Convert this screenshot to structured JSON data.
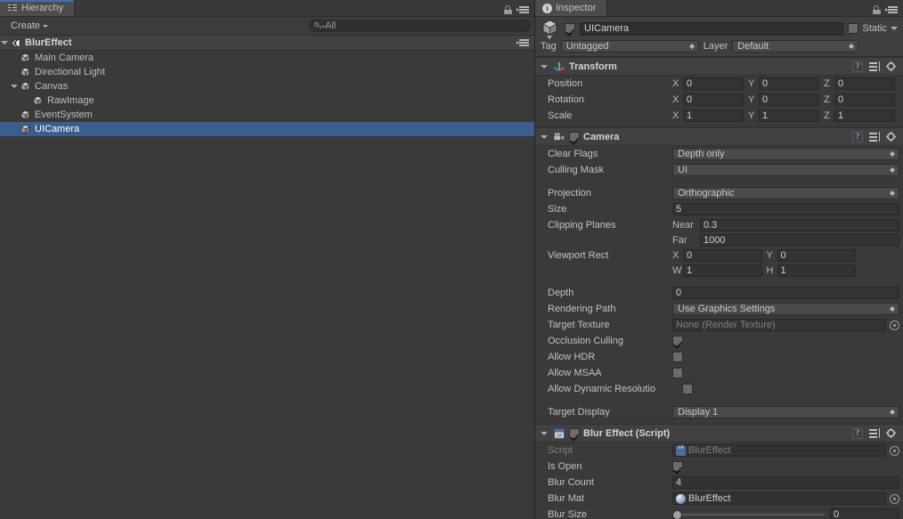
{
  "hierarchy": {
    "tab_label": "Hierarchy",
    "tab_icon": "hierarchy-icon",
    "lock_icon": "lock-icon",
    "menu_icon": "hamburger-menu-icon",
    "toolbar": {
      "create_label": "Create",
      "search_value": "All",
      "search_icon": "search-icon"
    },
    "scene": {
      "name": "BlurEffect",
      "icon": "unity-scene-icon",
      "expanded": true
    },
    "items": [
      {
        "label": "Main Camera",
        "icon": "gameobject-cube-icon",
        "depth": 1,
        "expandable": false,
        "selected": false
      },
      {
        "label": "Directional Light",
        "icon": "gameobject-cube-icon",
        "depth": 1,
        "expandable": false,
        "selected": false
      },
      {
        "label": "Canvas",
        "icon": "gameobject-cube-icon",
        "depth": 1,
        "expandable": true,
        "selected": false
      },
      {
        "label": "RawImage",
        "icon": "gameobject-cube-icon",
        "depth": 2,
        "expandable": false,
        "selected": false
      },
      {
        "label": "EventSystem",
        "icon": "gameobject-cube-icon",
        "depth": 1,
        "expandable": false,
        "selected": false
      },
      {
        "label": "UICamera",
        "icon": "gameobject-cube-icon",
        "depth": 1,
        "expandable": false,
        "selected": true
      }
    ]
  },
  "inspector": {
    "tab_label": "Inspector",
    "tab_icon": "info-icon",
    "lock_icon": "lock-icon",
    "menu_icon": "hamburger-menu-icon",
    "object": {
      "icon": "gameobject-cube-icon",
      "enabled": true,
      "name": "UICamera",
      "static_label": "Static",
      "static_checked": false,
      "tag_label": "Tag",
      "tag_value": "Untagged",
      "layer_label": "Layer",
      "layer_value": "Default"
    },
    "components": [
      {
        "title": "Transform",
        "icon": "transform-gizmo-icon",
        "has_enable_checkbox": false,
        "expanded": true,
        "tools": [
          "help-icon",
          "preset-icon",
          "gear-icon"
        ],
        "vectors": [
          {
            "label": "Position",
            "x": "0",
            "y": "0",
            "z": "0"
          },
          {
            "label": "Rotation",
            "x": "0",
            "y": "0",
            "z": "0"
          },
          {
            "label": "Scale",
            "x": "1",
            "y": "1",
            "z": "1"
          }
        ]
      },
      {
        "title": "Camera",
        "icon": "camera-icon",
        "has_enable_checkbox": true,
        "enabled": true,
        "expanded": true,
        "tools": [
          "help-icon",
          "preset-icon",
          "gear-icon"
        ],
        "fields": {
          "clear_flags_label": "Clear Flags",
          "clear_flags_value": "Depth only",
          "culling_mask_label": "Culling Mask",
          "culling_mask_value": "UI",
          "projection_label": "Projection",
          "projection_value": "Orthographic",
          "size_label": "Size",
          "size_value": "5",
          "clipping_label": "Clipping Planes",
          "near_label": "Near",
          "near_value": "0.3",
          "far_label": "Far",
          "far_value": "1000",
          "viewport_label": "Viewport Rect",
          "viewport_x_label": "X",
          "viewport_x": "0",
          "viewport_y_label": "Y",
          "viewport_y": "0",
          "viewport_w_label": "W",
          "viewport_w": "1",
          "viewport_h_label": "H",
          "viewport_h": "1",
          "depth_label": "Depth",
          "depth_value": "0",
          "rendering_path_label": "Rendering Path",
          "rendering_path_value": "Use Graphics Settings",
          "target_texture_label": "Target Texture",
          "target_texture_value": "None (Render Texture)",
          "occlusion_label": "Occlusion Culling",
          "occlusion_checked": true,
          "hdr_label": "Allow HDR",
          "hdr_checked": false,
          "msaa_label": "Allow MSAA",
          "msaa_checked": false,
          "dynres_label": "Allow Dynamic Resolutio",
          "dynres_checked": false,
          "target_display_label": "Target Display",
          "target_display_value": "Display 1"
        }
      },
      {
        "title": "Blur Effect (Script)",
        "icon": "csharp-script-icon",
        "has_enable_checkbox": true,
        "enabled": true,
        "expanded": true,
        "tools": [
          "help-icon",
          "preset-icon",
          "gear-icon"
        ],
        "fields": {
          "script_label": "Script",
          "script_value": "BlurEffect",
          "is_open_label": "Is Open",
          "is_open_checked": true,
          "blur_count_label": "Blur Count",
          "blur_count_value": "4",
          "blur_mat_label": "Blur Mat",
          "blur_mat_value": "BlurEffect",
          "blur_size_label": "Blur Size",
          "blur_size_value": "0",
          "blur_size_percent": 0
        }
      }
    ]
  },
  "colors": {
    "panel_bg": "#3a3a3a",
    "header_bg": "#414141",
    "selection_blue": "#3b5e8c",
    "tab_active_accent": "#3d6fa8",
    "field_bg": "#333333",
    "text": "#c2c2c2"
  }
}
